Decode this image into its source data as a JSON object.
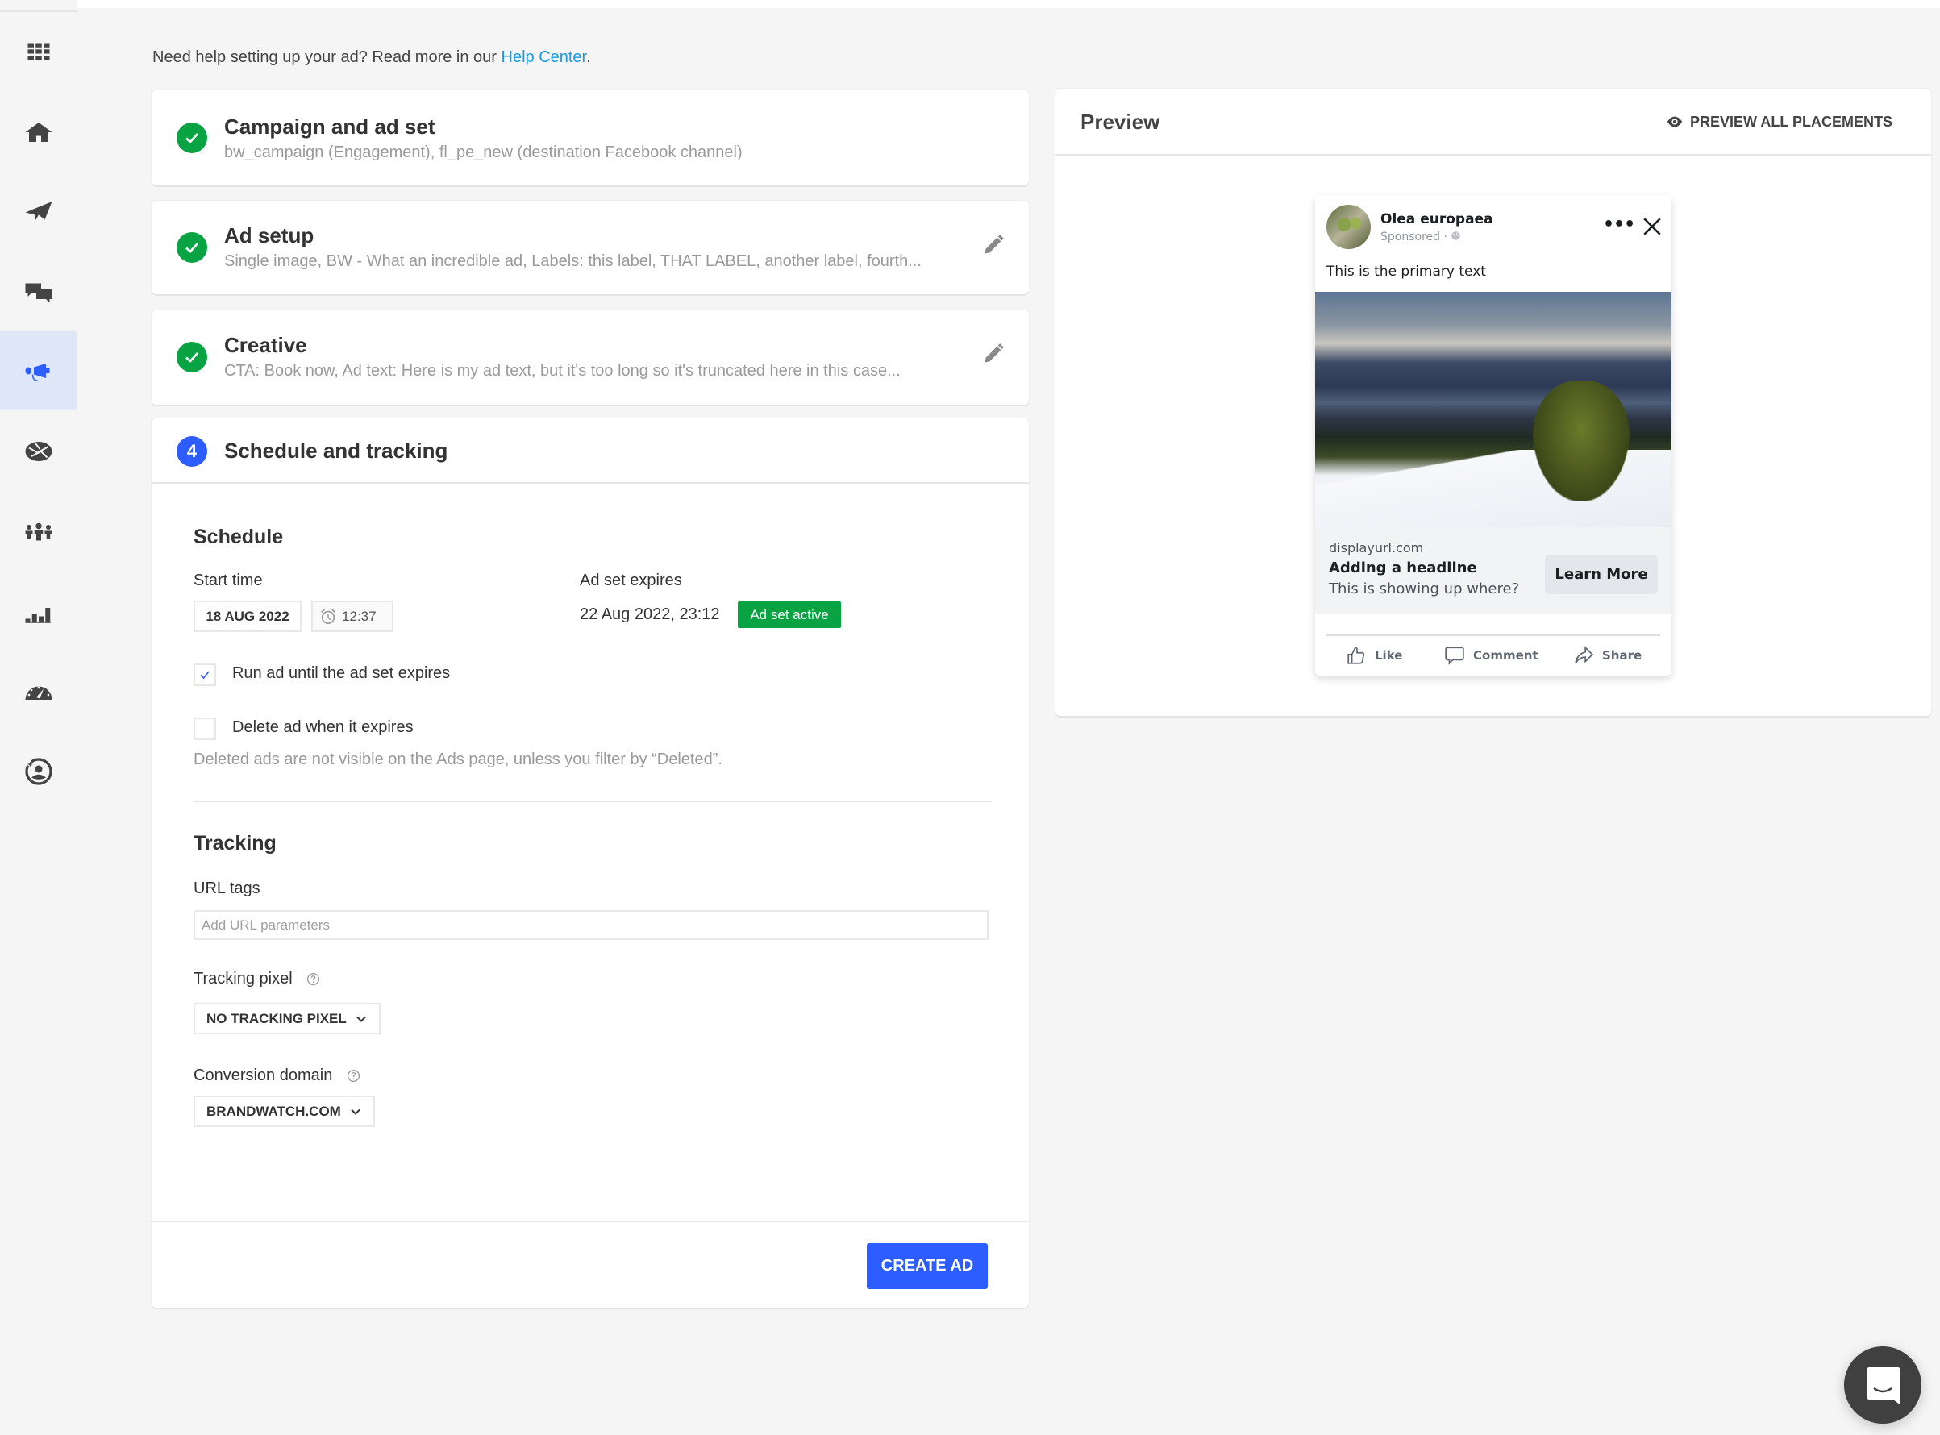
{
  "sidebar": {
    "items": [
      {
        "name": "apps",
        "icon": "grid-icon",
        "active": false
      },
      {
        "name": "home",
        "icon": "home-icon",
        "active": false
      },
      {
        "name": "publish",
        "icon": "paper-plane-icon",
        "active": false
      },
      {
        "name": "engage",
        "icon": "chat-bubbles-icon",
        "active": false
      },
      {
        "name": "advertise",
        "icon": "megaphone-icon",
        "active": true
      },
      {
        "name": "listen",
        "icon": "globe-icon",
        "active": false
      },
      {
        "name": "audience",
        "icon": "people-icon",
        "active": false
      },
      {
        "name": "measure",
        "icon": "bar-chart-icon",
        "active": false
      },
      {
        "name": "benchmark",
        "icon": "speedometer-icon",
        "active": false
      },
      {
        "name": "influence",
        "icon": "user-star-icon",
        "active": false
      }
    ]
  },
  "help": {
    "text": "Need help setting up your ad? Read more in our ",
    "link": "Help Center",
    "suffix": "."
  },
  "steps": [
    {
      "title": "Campaign and ad set",
      "summary": "bw_campaign (Engagement), fl_pe_new (destination Facebook channel)",
      "status": "complete",
      "editable": false
    },
    {
      "title": "Ad setup",
      "summary": "Single image, BW - What an incredible ad, Labels: this label, THAT LABEL, another label, fourth...",
      "status": "complete",
      "editable": true
    },
    {
      "title": "Creative",
      "summary": "CTA: Book now, Ad text: Here is my ad text, but it's too long so it's truncated here in this case...",
      "status": "complete",
      "editable": true
    }
  ],
  "schedule_step": {
    "number": "4",
    "title": "Schedule and tracking",
    "schedule": {
      "heading": "Schedule",
      "start_time_label": "Start time",
      "start_date": "18 AUG 2022",
      "start_time": "12:37",
      "expires_label": "Ad set expires",
      "expires_value": "22 Aug 2022, 23:12",
      "badge": "Ad set active",
      "run_until_label": "Run ad until the ad set expires",
      "run_until_checked": true,
      "delete_label": "Delete ad when it expires",
      "delete_checked": false,
      "delete_note": "Deleted ads are not visible on the Ads page, unless you filter by “Deleted”."
    },
    "tracking": {
      "heading": "Tracking",
      "url_tags_label": "URL tags",
      "url_tags_value": "",
      "url_tags_placeholder": "Add URL parameters",
      "pixel_label": "Tracking pixel",
      "pixel_value": "NO TRACKING PIXEL",
      "domain_label": "Conversion domain",
      "domain_value": "BRANDWATCH.COM"
    },
    "create_label": "CREATE AD"
  },
  "preview": {
    "title": "Preview",
    "all_placements_label": "PREVIEW ALL PLACEMENTS",
    "ad": {
      "page_name": "Olea europaea",
      "sponsored": "Sponsored ·",
      "primary_text": "This is the primary text",
      "display_url": "displayurl.com",
      "headline": "Adding a headline",
      "description": "This is showing up where?",
      "cta": "Learn More",
      "actions": [
        "Like",
        "Comment",
        "Share"
      ]
    }
  },
  "colors": {
    "accent": "#2d5cff",
    "success": "#0aa344",
    "link": "#1a9be6",
    "active_nav_bg": "#dfe7f9"
  }
}
